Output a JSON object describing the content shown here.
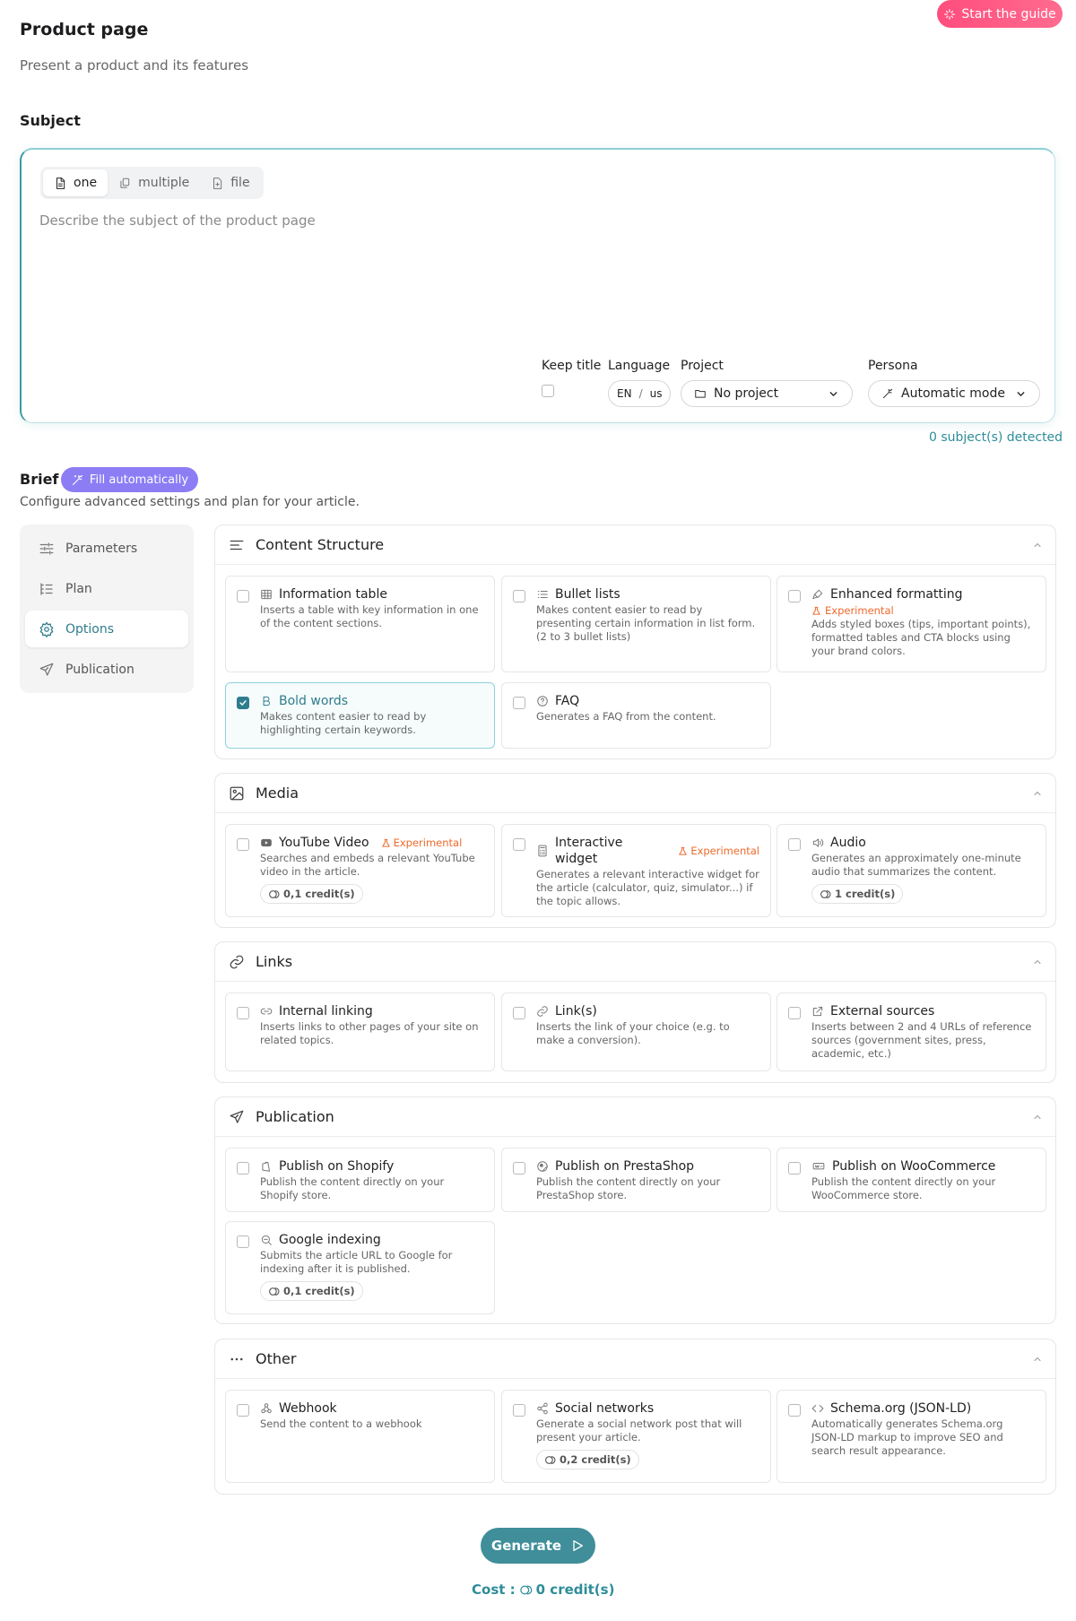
{
  "header": {
    "guide_button": "Start the guide",
    "title": "Product page",
    "description": "Present a product and its features"
  },
  "subject": {
    "heading": "Subject",
    "modes": [
      "one",
      "multiple",
      "file"
    ],
    "active_mode": "one",
    "placeholder": "Describe the subject of the product page",
    "value": "",
    "keep_title_label": "Keep title",
    "keep_title_checked": false,
    "language_label": "Language",
    "language_code": "EN",
    "language_separator": "/",
    "language_region": "us",
    "project_label": "Project",
    "project_value": "No project",
    "persona_label": "Persona",
    "persona_value": "Automatic mode",
    "detected": "0 subject(s) detected"
  },
  "brief": {
    "heading": "Brief",
    "fill_button": "Fill automatically",
    "description": "Configure advanced settings and plan for your article."
  },
  "sidenav": {
    "items": [
      {
        "label": "Parameters",
        "icon": "sliders-icon",
        "active": false
      },
      {
        "label": "Plan",
        "icon": "list-tree-icon",
        "active": false
      },
      {
        "label": "Options",
        "icon": "gear-icon",
        "active": true
      },
      {
        "label": "Publication",
        "icon": "send-icon",
        "active": false
      }
    ]
  },
  "sections": {
    "content": {
      "title": "Content Structure",
      "cards": [
        {
          "title": "Information table",
          "desc": "Inserts a table with key information in one of the content sections.",
          "checked": false,
          "icon": "table-icon"
        },
        {
          "title": "Bullet lists",
          "desc": "Makes content easier to read by presenting certain information in list form. (2 to 3 bullet lists)",
          "checked": false,
          "icon": "list-icon"
        },
        {
          "title": "Enhanced formatting",
          "exp": "Experimental",
          "desc": "Adds styled boxes (tips, important points), formatted tables and CTA blocks using your brand colors.",
          "checked": false,
          "icon": "brush-icon"
        },
        {
          "title": "Bold words",
          "desc": "Makes content easier to read by highlighting certain keywords.",
          "checked": true,
          "icon": "bold-icon"
        },
        {
          "title": "FAQ",
          "desc": "Generates a FAQ from the content.",
          "checked": false,
          "icon": "help-circle-icon"
        }
      ]
    },
    "media": {
      "title": "Media",
      "cards": [
        {
          "title": "YouTube Video",
          "exp": "Experimental",
          "desc": "Searches and embeds a relevant YouTube video in the article.",
          "credit": "0,1 credit(s)",
          "checked": false,
          "icon": "youtube-icon"
        },
        {
          "title": "Interactive widget",
          "exp": "Experimental",
          "desc": "Generates a relevant interactive widget for the article (calculator, quiz, simulator...) if the topic allows.",
          "checked": false,
          "icon": "calculator-icon"
        },
        {
          "title": "Audio",
          "desc": "Generates an approximately one-minute audio that summarizes the content.",
          "credit": "1 credit(s)",
          "checked": false,
          "icon": "speaker-icon"
        }
      ]
    },
    "links": {
      "title": "Links",
      "cards": [
        {
          "title": "Internal linking",
          "desc": "Inserts links to other pages of your site on related topics.",
          "checked": false,
          "icon": "link-icon"
        },
        {
          "title": "Link(s)",
          "desc": "Inserts the link of your choice (e.g. to make a conversion).",
          "checked": false,
          "icon": "link-icon"
        },
        {
          "title": "External sources",
          "desc": "Inserts between 2 and 4 URLs of reference sources (government sites, press, academic, etc.)",
          "checked": false,
          "icon": "external-link-icon"
        }
      ]
    },
    "publication": {
      "title": "Publication",
      "cards": [
        {
          "title": "Publish on Shopify",
          "desc": "Publish the content directly on your Shopify store.",
          "checked": false,
          "icon": "shopify-icon"
        },
        {
          "title": "Publish on PrestaShop",
          "desc": "Publish the content directly on your PrestaShop store.",
          "checked": false,
          "icon": "prestashop-icon"
        },
        {
          "title": "Publish on WooCommerce",
          "desc": "Publish the content directly on your WooCommerce store.",
          "checked": false,
          "icon": "woocommerce-icon"
        },
        {
          "title": "Google indexing",
          "desc": "Submits the article URL to Google for indexing after it is published.",
          "credit": "0,1 credit(s)",
          "checked": false,
          "icon": "search-icon"
        }
      ]
    },
    "other": {
      "title": "Other",
      "cards": [
        {
          "title": "Webhook",
          "desc": "Send the content to a webhook",
          "checked": false,
          "icon": "webhook-icon"
        },
        {
          "title": "Social networks",
          "desc": "Generate a social network post that will present your article.",
          "credit": "0,2 credit(s)",
          "checked": false,
          "icon": "share-icon"
        },
        {
          "title": "Schema.org (JSON-LD)",
          "desc": "Automatically generates Schema.org JSON-LD markup to improve SEO and search result appearance.",
          "checked": false,
          "icon": "code-icon"
        }
      ]
    }
  },
  "footer": {
    "generate_button": "Generate",
    "cost_label": "Cost :",
    "cost_value": "0 credit(s)"
  },
  "colors": {
    "accent": "#2e7d8c",
    "guide_button": "#ff5a83",
    "fill_button": "#8d7df5",
    "experimental": "#ee6a2c",
    "generate_button": "#3f8e99"
  }
}
